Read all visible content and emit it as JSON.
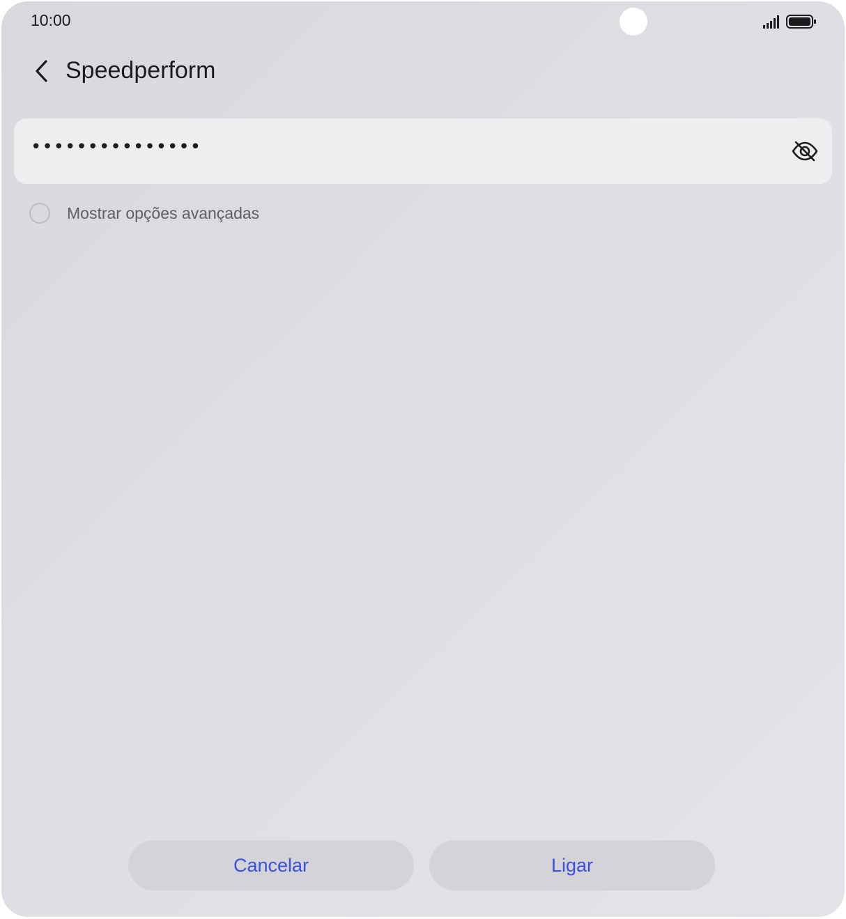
{
  "status_bar": {
    "time": "10:00",
    "icons": [
      "signal-icon",
      "battery-icon"
    ]
  },
  "header": {
    "back_icon": "chevron-left-icon",
    "title": "Speedperform"
  },
  "password_field": {
    "masked_value": "•••••••••••••••",
    "visibility_icon": "eye-off-icon"
  },
  "advanced_options": {
    "label": "Mostrar opções avançadas",
    "checked": false
  },
  "actions": {
    "cancel_label": "Cancelar",
    "connect_label": "Ligar"
  },
  "colors": {
    "accent": "#3b4fe0",
    "background": "#dfdee3",
    "field_background": "#eeeef0",
    "button_background": "#d3d3d8"
  }
}
